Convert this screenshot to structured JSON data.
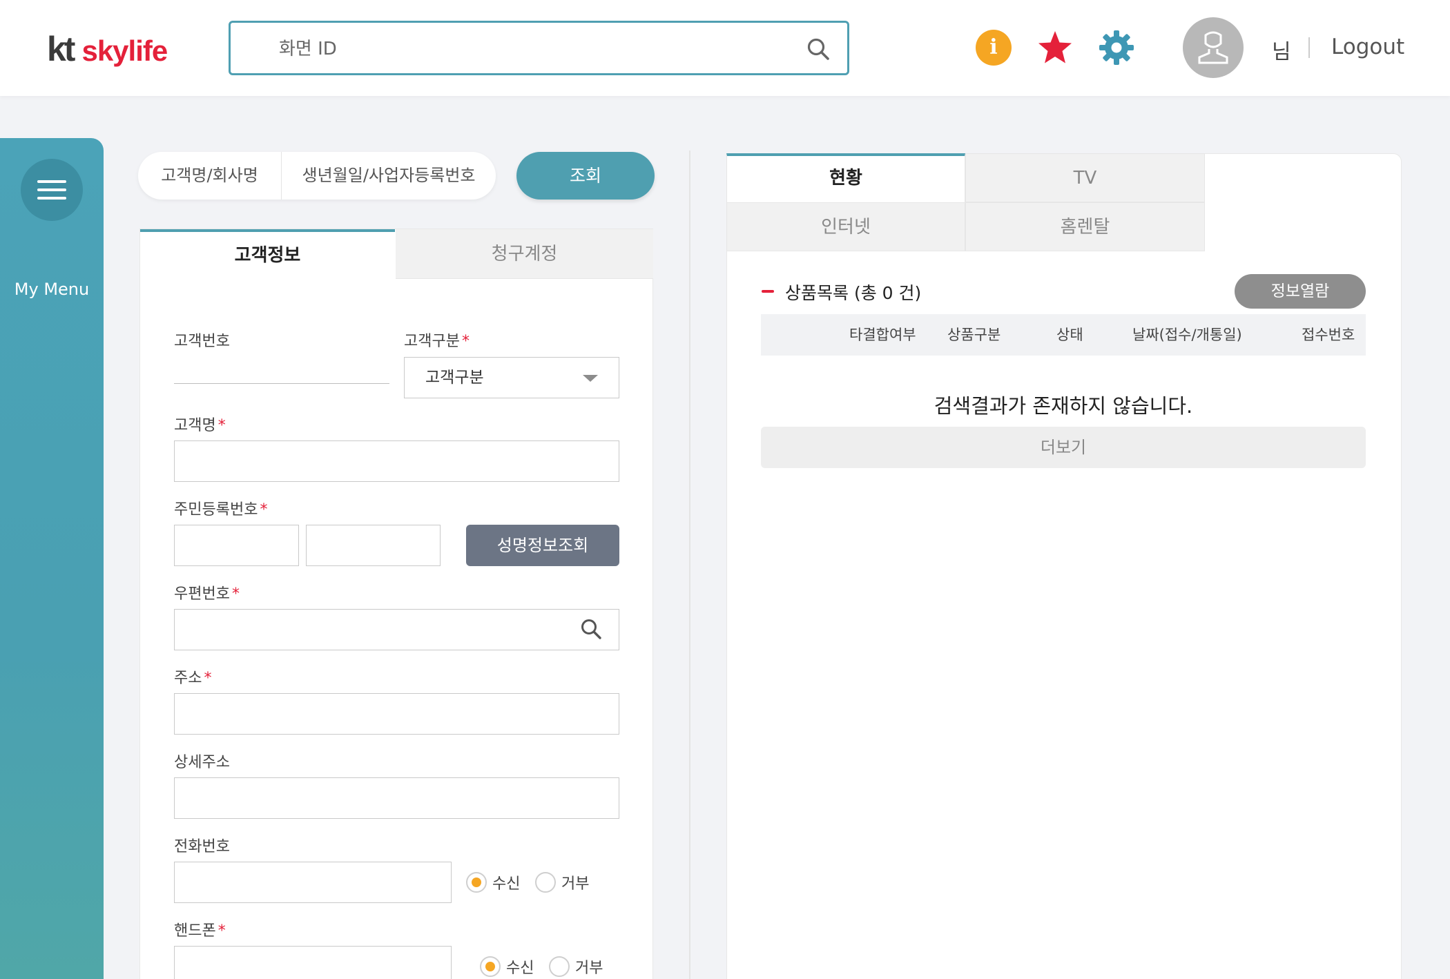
{
  "header": {
    "logo_kt": "kt",
    "logo_sky": "skylife",
    "search_placeholder": "화면 ID",
    "user_suffix": "님",
    "logout_label": "Logout",
    "colors": {
      "accent": "#4f9fb2",
      "brand_red": "#e4213a",
      "info": "#f5a623",
      "gear": "#3e97b4"
    }
  },
  "sidebar": {
    "menu_label": "My Menu"
  },
  "search": {
    "tabs": [
      "고객명/회사명",
      "생년월일/사업자등록번호"
    ],
    "query_button": "조회"
  },
  "form": {
    "tabs": [
      "고객정보",
      "청구계정"
    ],
    "labels": {
      "customer_no": "고객번호",
      "customer_type": "고객구분",
      "customer_name": "고객명",
      "rrn": "주민등록번호",
      "zip": "우편번호",
      "address": "주소",
      "address_detail": "상세주소",
      "phone": "전화번호",
      "mobile": "핸드폰"
    },
    "required_mark": "*",
    "customer_type_value": "고객구분",
    "name_lookup_button": "성명정보조회",
    "radio": {
      "accept": "수신",
      "reject": "거부"
    }
  },
  "right": {
    "tabs": [
      "현황",
      "TV",
      "인터넷",
      "홈렌탈"
    ],
    "product_list_title": "상품목록 (총 0 건)",
    "info_view_button": "정보열람",
    "table_headers": [
      "타결합여부",
      "상품구분",
      "상태",
      "날짜(접수/개통일)",
      "접수번호"
    ],
    "empty_message": "검색결과가 존재하지 않습니다.",
    "more_button": "더보기"
  }
}
